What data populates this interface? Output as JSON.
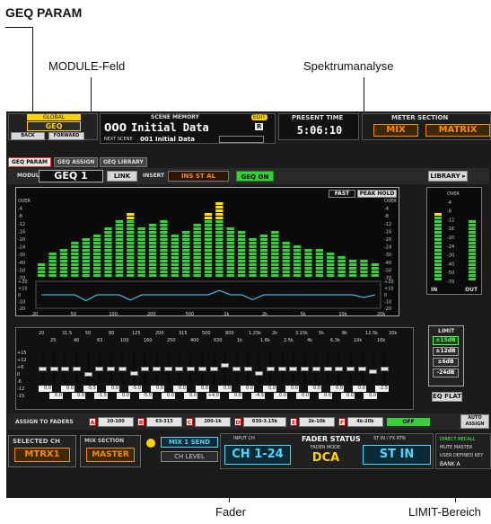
{
  "callouts": {
    "geq_param": "GEQ PARAM",
    "module_field": "MODULE-Feld",
    "spectrum": "Spektrumanalyse",
    "fader": "Fader",
    "limit_area": "LIMIT-Bereich"
  },
  "header": {
    "global_label": "GLOBAL",
    "global_value": "GEQ",
    "back_label": "BACK",
    "forward_label": "FORWARD",
    "scene_memory_label": "SCENE MEMORY",
    "edit_badge": "EDIT",
    "scene_number": "000",
    "scene_title": "Initial Data",
    "scene_flag": "R",
    "next_scene_label": "NEXT SCENE",
    "next_scene_value": "001 Initial Data",
    "present_time_label": "PRESENT TIME",
    "present_time_value": "5:06:10",
    "meter_section_label": "METER SECTION",
    "meter_mix": "MIX",
    "meter_matrix": "MATRIX"
  },
  "tabs": [
    "GEQ PARAM",
    "GEQ ASSIGN",
    "GEQ LIBRARY"
  ],
  "module": {
    "label": "MODULE",
    "value": "GEQ 1",
    "link_label": "LINK",
    "insert_label": "INSERT",
    "insert_value": "INS ST AL",
    "geq_on_label": "GEQ ON",
    "library_label": "LIBRARY"
  },
  "spectrum": {
    "fast_label": "FAST",
    "peak_hold_label": "PEAK HOLD",
    "scale": [
      "OVER",
      "-4",
      "-8",
      "-12",
      "-16",
      "-20",
      "-24",
      "-30",
      "-40",
      "-50",
      "-70"
    ],
    "bar_levels": [
      0.2,
      0.3,
      0.38,
      0.45,
      0.5,
      0.56,
      0.65,
      0.72,
      0.8,
      0.62,
      0.68,
      0.74,
      0.55,
      0.6,
      0.66,
      0.82,
      0.95,
      0.62,
      0.58,
      0.52,
      0.55,
      0.6,
      0.46,
      0.4,
      0.36,
      0.38,
      0.32,
      0.28,
      0.24,
      0.22,
      0.2
    ],
    "curve_scale": [
      "+20",
      "+10",
      "0",
      "-10",
      "-20"
    ],
    "freq_axis": [
      "20",
      "50",
      "100",
      "200",
      "500",
      "1k",
      "2k",
      "5k",
      "10k",
      "20k"
    ]
  },
  "master_meter": {
    "scale": [
      "OVER",
      "-4",
      "-8",
      "-12",
      "-16",
      "-20",
      "-24",
      "-30",
      "-40",
      "-50",
      "-70"
    ],
    "in_label": "IN",
    "out_label": "OUT",
    "in_level": 0.78,
    "out_level": 0.72
  },
  "faders": {
    "freq_row1": [
      "20",
      "31.5",
      "50",
      "80",
      "125",
      "200",
      "315",
      "500",
      "800",
      "1.25k",
      "2k",
      "3.15k",
      "5k",
      "8k",
      "12.5k",
      "20k"
    ],
    "freq_row2": [
      "25",
      "40",
      "63",
      "100",
      "160",
      "250",
      "400",
      "630",
      "1k",
      "1.6k",
      "2.5k",
      "4k",
      "6.3k",
      "10k",
      "16k"
    ],
    "scale": [
      "+15",
      "+12",
      "+6",
      "0",
      "-6",
      "-12",
      "-15"
    ],
    "gains": [
      0.0,
      0.0,
      0.0,
      0.0,
      -5.5,
      0.0,
      0.0,
      0.0,
      -5.0,
      0.0,
      0.0,
      0.0,
      0.0,
      0.0,
      0.0,
      0.0,
      4.0,
      0.0,
      0.0,
      -4.5,
      0.0,
      0.0,
      0.0,
      0.0,
      0.0,
      0.0,
      0.0,
      0.0,
      0.0,
      -2.5,
      0.0
    ],
    "values_row1": [
      "0.0",
      "0.0",
      "-5.5",
      "0.0",
      "-5.0",
      "0.0",
      "0.0",
      "0.0",
      "0.0",
      "0.0",
      "0.0",
      "0.0",
      "0.0",
      "0.0",
      "0.0",
      "-2.5"
    ],
    "values_row2": [
      "0.0",
      "0.0",
      "-1.5",
      "0.0",
      "-5.0",
      "0.0",
      "0.0",
      "+4.0",
      "0.0",
      "-4.5",
      "0.0",
      "0.0",
      "0.0",
      "0.0",
      "0.0"
    ]
  },
  "limit": {
    "title": "LIMIT",
    "options": [
      "±15dB",
      "±12dB",
      "±6dB",
      "-24dB"
    ],
    "selected": "±15dB",
    "eq_flat_label": "EQ FLAT"
  },
  "assign": {
    "label": "ASSIGN TO FADERS",
    "groups": [
      {
        "letter": "A",
        "range": "20-100"
      },
      {
        "letter": "B",
        "range": "63-315"
      },
      {
        "letter": "C",
        "range": "200-1k"
      },
      {
        "letter": "D",
        "range": "630-3.15k"
      },
      {
        "letter": "E",
        "range": "2k-10k"
      },
      {
        "letter": "F",
        "range": "4k-20k"
      }
    ],
    "off_label": "OFF",
    "auto_assign_label": "AUTO ASSIGN"
  },
  "footer": {
    "selected_ch_label": "SELECTED CH",
    "selected_ch_value": "MTRX1",
    "mix_section_label": "MIX SECTION",
    "mix_section_value": "MASTER",
    "mix_send_label": "MIX 1 SEND",
    "ch_level_label": "CH LEVEL",
    "fader_status_label": "FADER STATUS",
    "input_ch_label": "INPUT CH",
    "input_ch_value": "CH 1-24",
    "fader_mode_label": "FADER MODE",
    "fader_mode_value": "DCA",
    "st_in_label": "ST IN / FX RTN",
    "st_in_value": "ST IN",
    "direct_recall_label": "DIRECT RECALL",
    "mute_master_label": "MUTE MASTER",
    "user_defined_label": "USER DEFINED KEY",
    "bank_label": "BANK A"
  },
  "colors": {
    "accent_orange": "#ff8a00",
    "meter_green": "#38d038",
    "meter_yellow": "#ffe000",
    "cyan": "#4ad8ff"
  }
}
